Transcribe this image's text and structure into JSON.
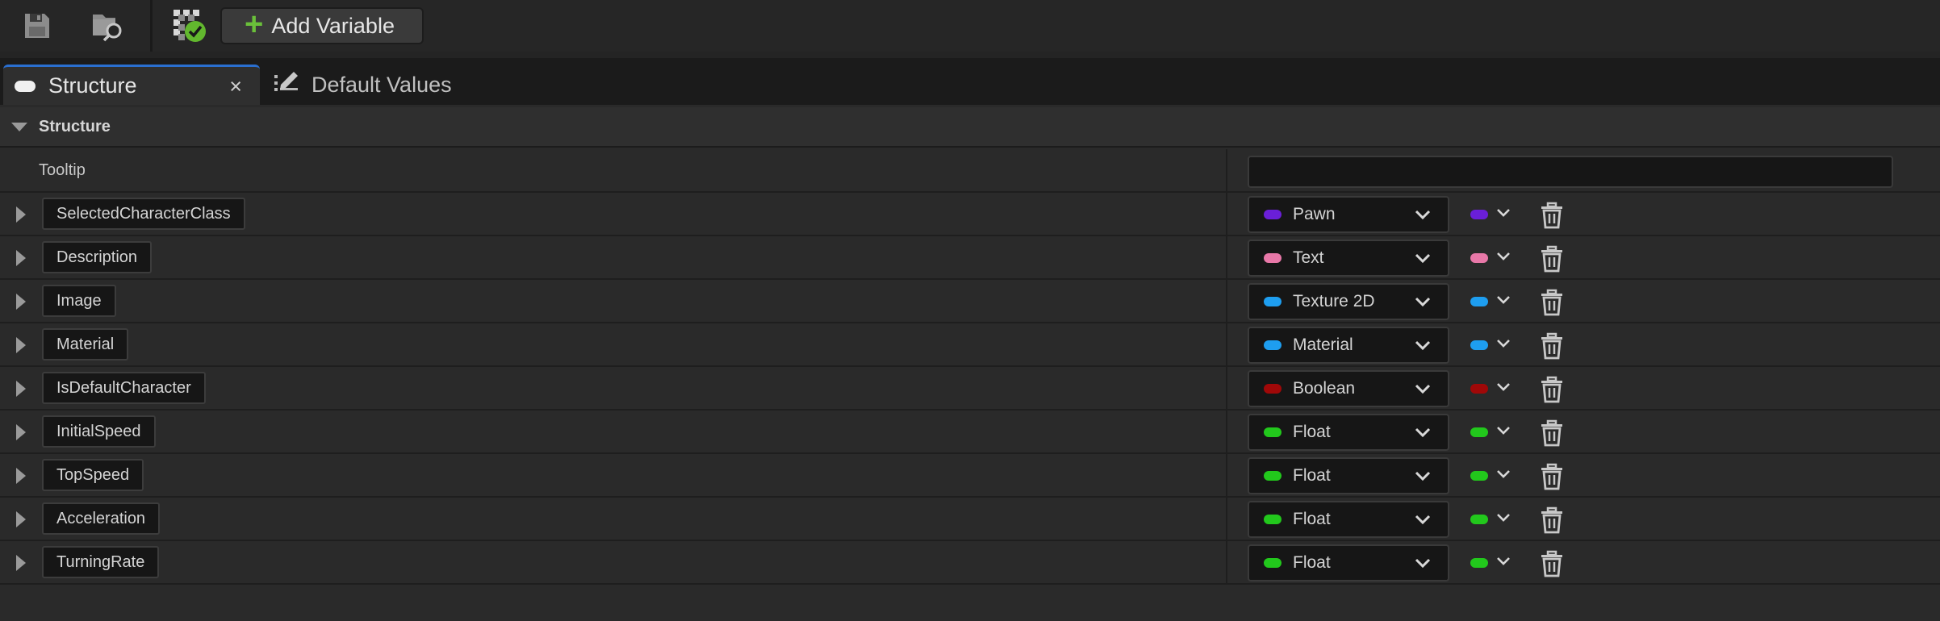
{
  "toolbar": {
    "save_icon": "save-icon",
    "browse_icon": "browse-folder-icon",
    "validate_icon": "validate-check-icon",
    "add_variable_label": "Add Variable"
  },
  "tabs": [
    {
      "label": "Structure",
      "icon": "pill-icon",
      "close": "×",
      "active": true
    },
    {
      "label": "Default Values",
      "icon": "edit-pencil-icon",
      "active": false
    }
  ],
  "section": {
    "title": "Structure",
    "tooltip_label": "Tooltip",
    "tooltip_value": ""
  },
  "variables": [
    {
      "name": "SelectedCharacterClass",
      "type": "Pawn",
      "color": "#6a1fd8"
    },
    {
      "name": "Description",
      "type": "Text",
      "color": "#e878a8"
    },
    {
      "name": "Image",
      "type": "Texture 2D",
      "color": "#1e9ef0"
    },
    {
      "name": "Material",
      "type": "Material",
      "color": "#1e9ef0"
    },
    {
      "name": "IsDefaultCharacter",
      "type": "Boolean",
      "color": "#a00808"
    },
    {
      "name": "InitialSpeed",
      "type": "Float",
      "color": "#22c81c"
    },
    {
      "name": "TopSpeed",
      "type": "Float",
      "color": "#22c81c"
    },
    {
      "name": "Acceleration",
      "type": "Float",
      "color": "#22c81c"
    },
    {
      "name": "TurningRate",
      "type": "Float",
      "color": "#22c81c"
    }
  ]
}
